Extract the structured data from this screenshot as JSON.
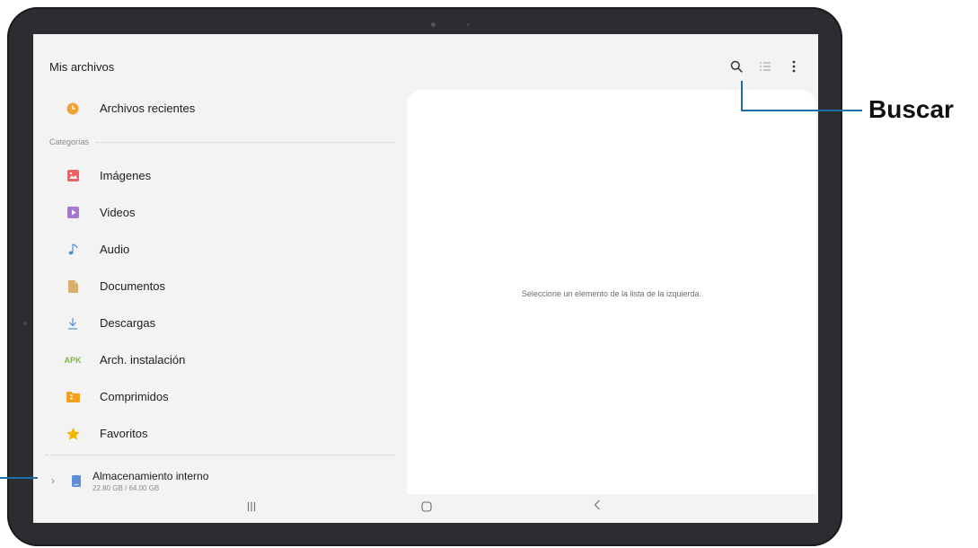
{
  "app": {
    "title": "Mis archivos"
  },
  "toolbar": {
    "search_icon": "search-icon",
    "list_view_icon": "list-view-icon",
    "more_icon": "more-options-icon"
  },
  "sidebar": {
    "recent": {
      "label": "Archivos recientes",
      "icon": "clock-icon",
      "color": "#f0a23a"
    },
    "categories_header": "Categorías",
    "categories": [
      {
        "label": "Imágenes",
        "icon": "image-icon",
        "color": "#ef5f63"
      },
      {
        "label": "Videos",
        "icon": "video-icon",
        "color": "#a678d2"
      },
      {
        "label": "Audio",
        "icon": "music-note-icon",
        "color": "#4a90d9"
      },
      {
        "label": "Documentos",
        "icon": "document-icon",
        "color": "#d8ad6e"
      },
      {
        "label": "Descargas",
        "icon": "download-icon",
        "color": "#4a90d9"
      },
      {
        "label": "Arch. instalación",
        "icon": "apk-icon",
        "icon_text": "APK",
        "color": "#7dbb3b"
      },
      {
        "label": "Comprimidos",
        "icon": "compressed-folder-icon",
        "color": "#f3a020"
      },
      {
        "label": "Favoritos",
        "icon": "star-icon",
        "color": "#f5b400"
      }
    ],
    "storage": {
      "name": "Almacenamiento interno",
      "usage": "22.80 GB / 64.00 GB",
      "icon": "phone-storage-icon",
      "color": "#5b8ed6"
    }
  },
  "detail": {
    "message": "Seleccione un elemento de la lista de la izquierda."
  },
  "navbar": {
    "recents_icon": "recent-apps-icon",
    "home_icon": "home-icon",
    "back_icon": "back-icon"
  },
  "callouts": {
    "search_label": "Buscar"
  },
  "colors": {
    "callout_line": "#1e6fa6",
    "screen_bg": "#f3f3f3",
    "device_frame": "#2b2d31"
  }
}
